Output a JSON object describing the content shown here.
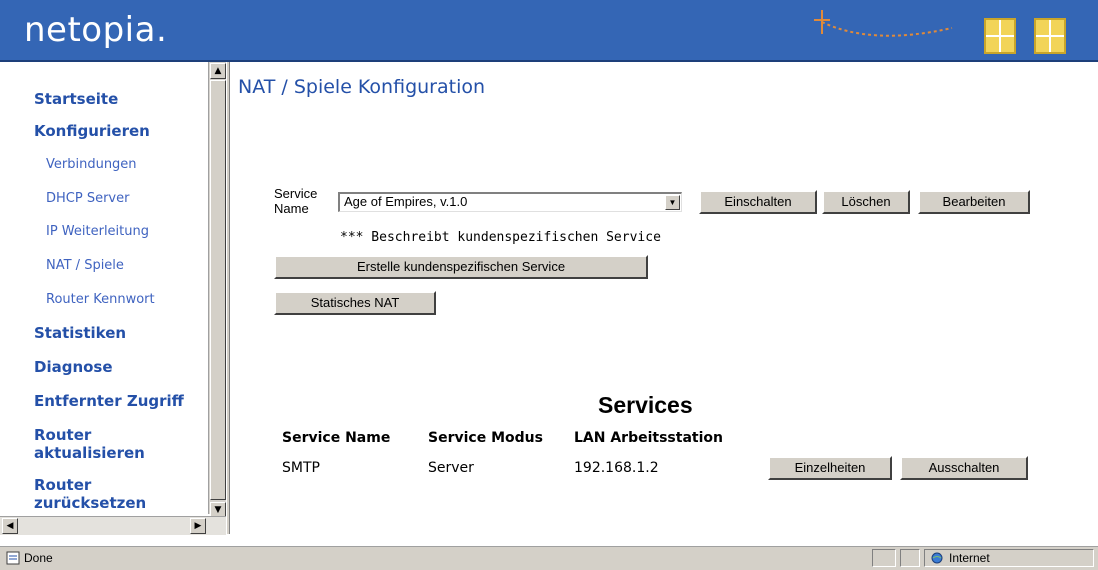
{
  "header": {
    "logo_text": "netopia."
  },
  "sidebar": {
    "items": [
      {
        "label": "Startseite"
      },
      {
        "label": "Konfigurieren"
      },
      {
        "label": "Verbindungen"
      },
      {
        "label": "DHCP Server"
      },
      {
        "label": "IP Weiterleitung"
      },
      {
        "label": "NAT / Spiele"
      },
      {
        "label": "Router Kennwort"
      },
      {
        "label": "Statistiken"
      },
      {
        "label": "Diagnose"
      },
      {
        "label": "Entfernter Zugriff"
      },
      {
        "label": "Router aktualisieren"
      },
      {
        "label": "Router zurücksetzen"
      }
    ]
  },
  "main": {
    "title": "NAT / Spiele Konfiguration",
    "service_name_label": "Service Name",
    "service_select_value": "Age of Empires, v.1.0",
    "btn_enable": "Einschalten",
    "btn_delete": "Löschen",
    "btn_edit": "Bearbeiten",
    "custom_note": "*** Beschreibt kundenspezifischen Service",
    "btn_create_custom": "Erstelle kundenspezifischen Service",
    "btn_static_nat": "Statisches NAT",
    "services": {
      "heading": "Services",
      "columns": [
        "Service Name",
        "Service Modus",
        "LAN Arbeitsstation"
      ],
      "rows": [
        {
          "name": "SMTP",
          "mode": "Server",
          "lan": "192.168.1.2",
          "btn_details": "Einzelheiten",
          "btn_disable": "Ausschalten"
        }
      ]
    }
  },
  "status": {
    "left_text": "Done",
    "zone_text": "Internet"
  },
  "colors": {
    "header_bg": "#3466b5",
    "nav_link": "#2450a8",
    "button_face": "#d4d0c8"
  }
}
